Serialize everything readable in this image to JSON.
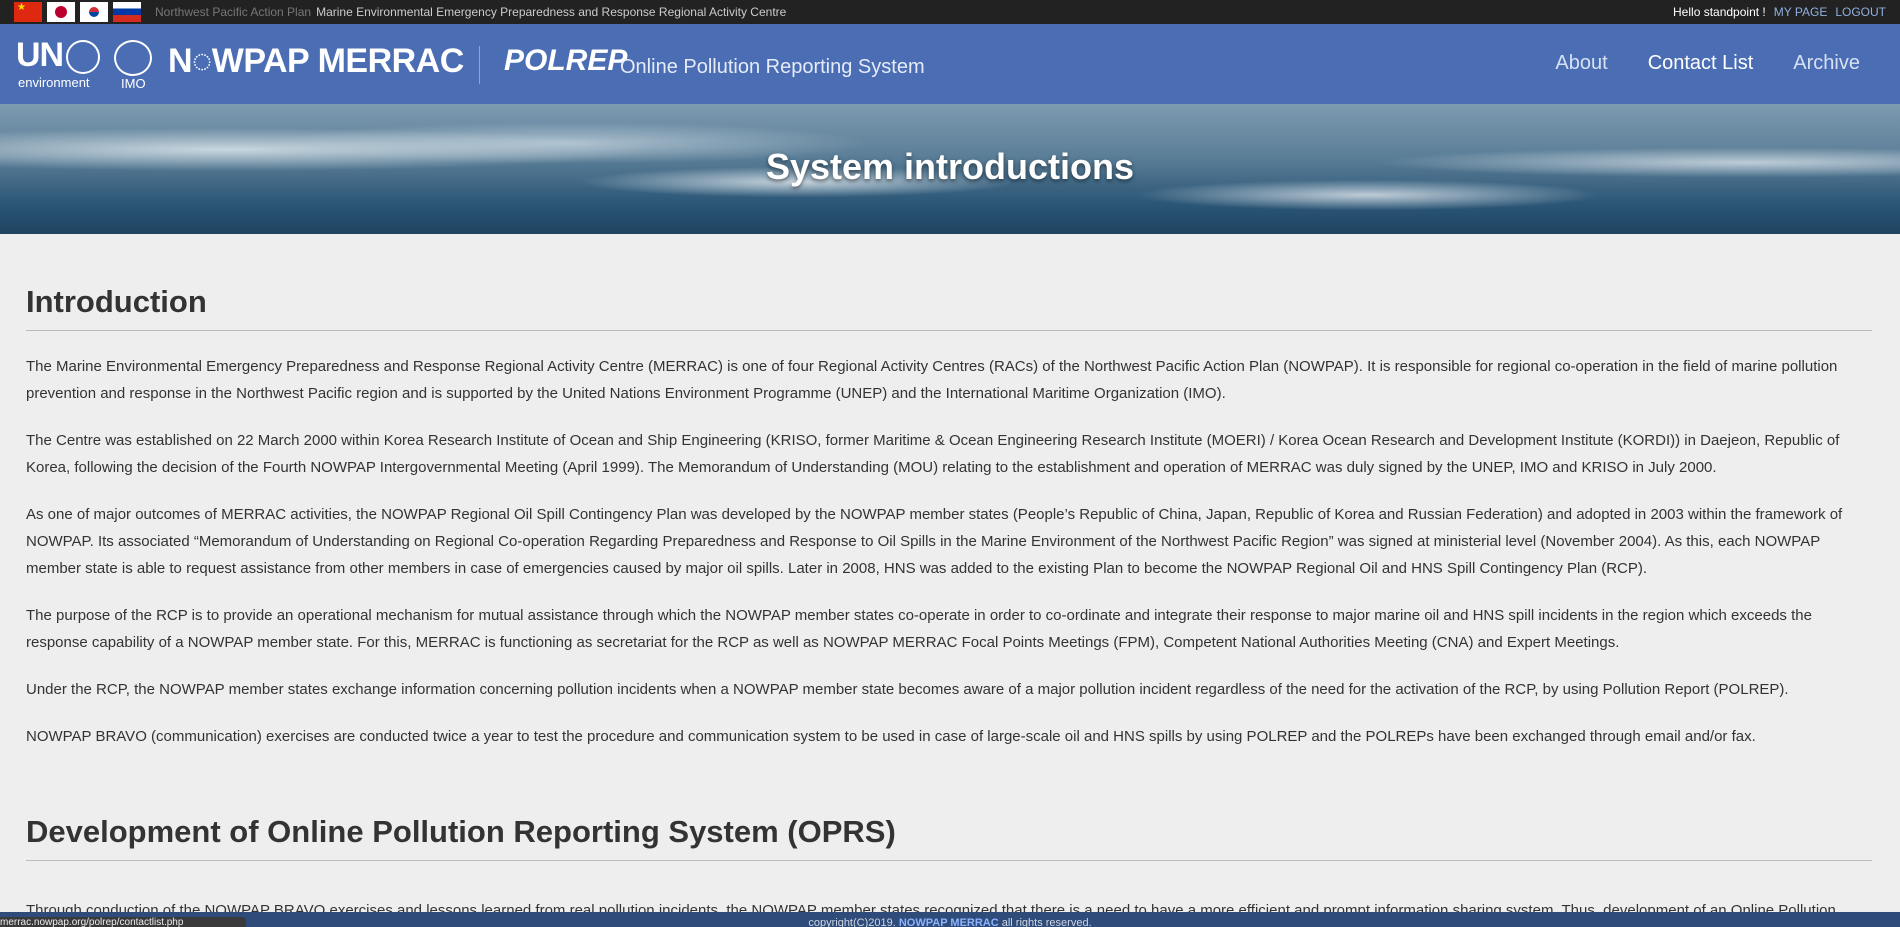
{
  "topbar": {
    "plan": "Northwest Pacific Action Plan",
    "centre": "Marine Environmental Emergency Preparedness and Response Regional Activity Centre",
    "hello": "Hello standpoint !",
    "mypage": "MY PAGE",
    "logout": "LOGOUT"
  },
  "header": {
    "un_text": "UN",
    "un_sub": "environment",
    "imo_sub": "IMO",
    "brand": "N◌WPAP MERRAC",
    "polrep": "POLREP",
    "oprs": "Online Pollution Reporting System",
    "nav": [
      "About",
      "Contact List",
      "Archive"
    ]
  },
  "hero": {
    "title": "System introductions"
  },
  "sections": {
    "intro_title": "Introduction",
    "intro_paras": [
      "The Marine Environmental Emergency Preparedness and Response Regional Activity Centre (MERRAC) is one of four Regional Activity Centres (RACs) of the Northwest Pacific Action Plan (NOWPAP). It is responsible for regional co-operation in the field of marine pollution prevention and response in the Northwest Pacific region and is supported by the United Nations Environment Programme (UNEP) and the International Maritime Organization (IMO).",
      "The Centre was established on 22 March 2000 within Korea Research Institute of Ocean and Ship Engineering (KRISO, former Maritime & Ocean Engineering Research Institute (MOERI) / Korea Ocean Research and Development Institute (KORDI)) in Daejeon, Republic of Korea, following the decision of the Fourth NOWPAP Intergovernmental Meeting (April 1999). The Memorandum of Understanding (MOU) relating to the establishment and operation of MERRAC was duly signed by the UNEP, IMO and KRISO in July 2000.",
      "As one of major outcomes of MERRAC activities, the NOWPAP Regional Oil Spill Contingency Plan was developed by the NOWPAP member states (People’s Republic of China, Japan, Republic of Korea and Russian Federation) and adopted in 2003 within the framework of NOWPAP. Its associated “Memorandum of Understanding on Regional Co-operation Regarding Preparedness and Response to Oil Spills in the Marine Environment of the Northwest Pacific Region” was signed at ministerial level (November 2004). As this, each NOWPAP member state is able to request assistance from other members in case of emergencies caused by major oil spills. Later in 2008, HNS was added to the existing Plan to become the NOWPAP Regional Oil and HNS Spill Contingency Plan (RCP).",
      "The purpose of the RCP is to provide an operational mechanism for mutual assistance through which the NOWPAP member states co-operate in order to co-ordinate and integrate their response to major marine oil and HNS spill incidents in the region which exceeds the response capability of a NOWPAP member state. For this, MERRAC is functioning as secretariat for the RCP as well as NOWPAP MERRAC Focal Points Meetings (FPM), Competent National Authorities Meeting (CNA) and Expert Meetings.",
      "Under the RCP, the NOWPAP member states exchange information concerning pollution incidents when a NOWPAP member state becomes aware of a major pollution incident regardless of the need for the activation of the RCP, by using Pollution Report (POLREP).",
      "NOWPAP BRAVO (communication) exercises are conducted twice a year to test the procedure and communication system to be used in case of large-scale oil and HNS spills by using POLREP and the POLREPs have been exchanged through email and/or fax."
    ],
    "dev_title": "Development of Online Pollution Reporting System (OPRS)",
    "dev_para": "Through conduction of the NOWPAP BRAVO exercises and lessons learned from real pollution incidents, the NOWPAP member states recognized that there is a need to have a more efficient and prompt information sharing system. Thus, development of an Online Pollution"
  },
  "footer": {
    "copyright_prefix": "copyright(C)2019.",
    "brand": "NOWPAP MERRAC",
    "suffix": "all rights reserved."
  },
  "status": {
    "url": "merrac.nowpap.org/polrep/contactlist.php"
  }
}
